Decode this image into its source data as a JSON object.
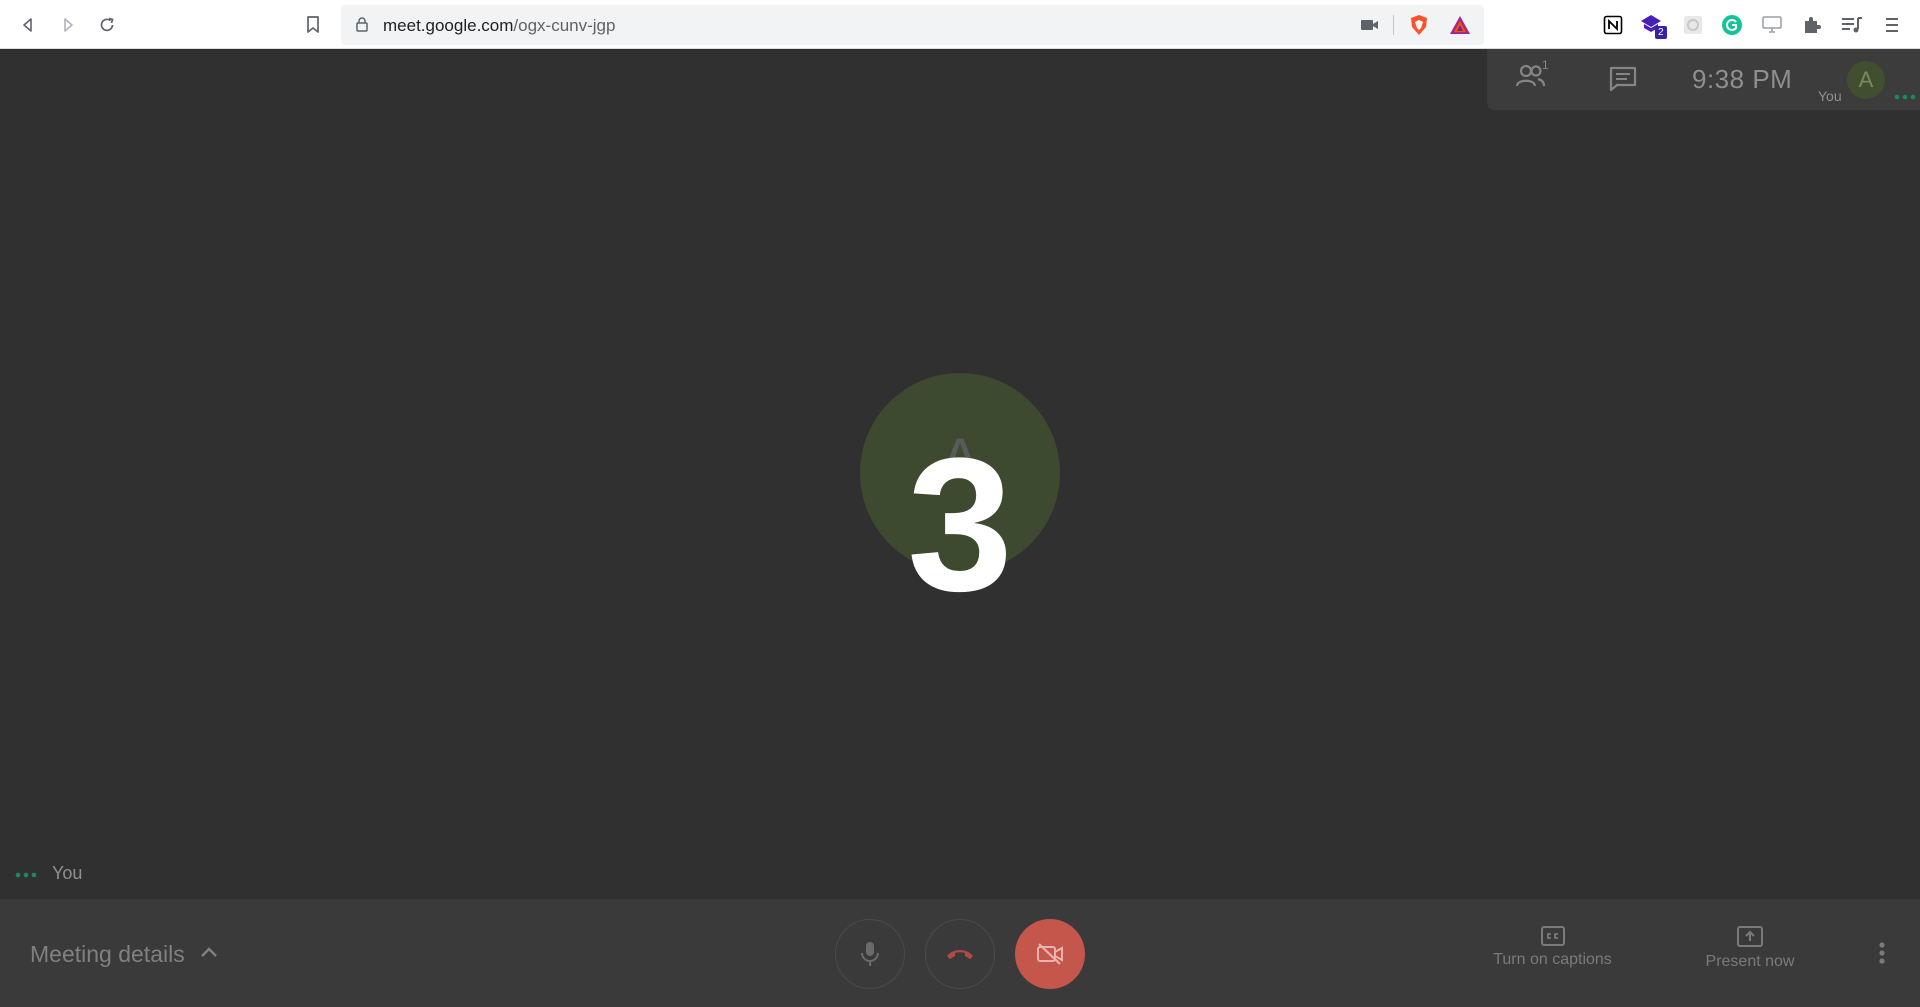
{
  "browser": {
    "url_host": "meet.google.com",
    "url_path": "/ogx-cunv-jgp",
    "extensions": [
      "camera-icon",
      "brave-shield-icon",
      "brave-rewards-icon",
      "notion-icon",
      "extension-badge-icon",
      "puzzle-grid-icon",
      "grammarly-icon",
      "screen-icon",
      "extensions-puzzle-icon",
      "playlist-icon",
      "menu-icon"
    ],
    "badge_count": "2"
  },
  "meet_top": {
    "participants_count": "1",
    "time": "9:38  PM",
    "you_label": "You",
    "avatar_letter": "A"
  },
  "stage": {
    "avatar_letter": "A",
    "countdown": "3",
    "you_label": "You"
  },
  "bottom_bar": {
    "meeting_details": "Meeting details",
    "captions_label": "Turn on captions",
    "present_label": "Present now"
  },
  "colors": {
    "stage_bg": "#303030",
    "bottombar_bg": "#3a3a3a",
    "camera_off_red": "#c4564b",
    "avatar_green": "#3e4a2f"
  }
}
